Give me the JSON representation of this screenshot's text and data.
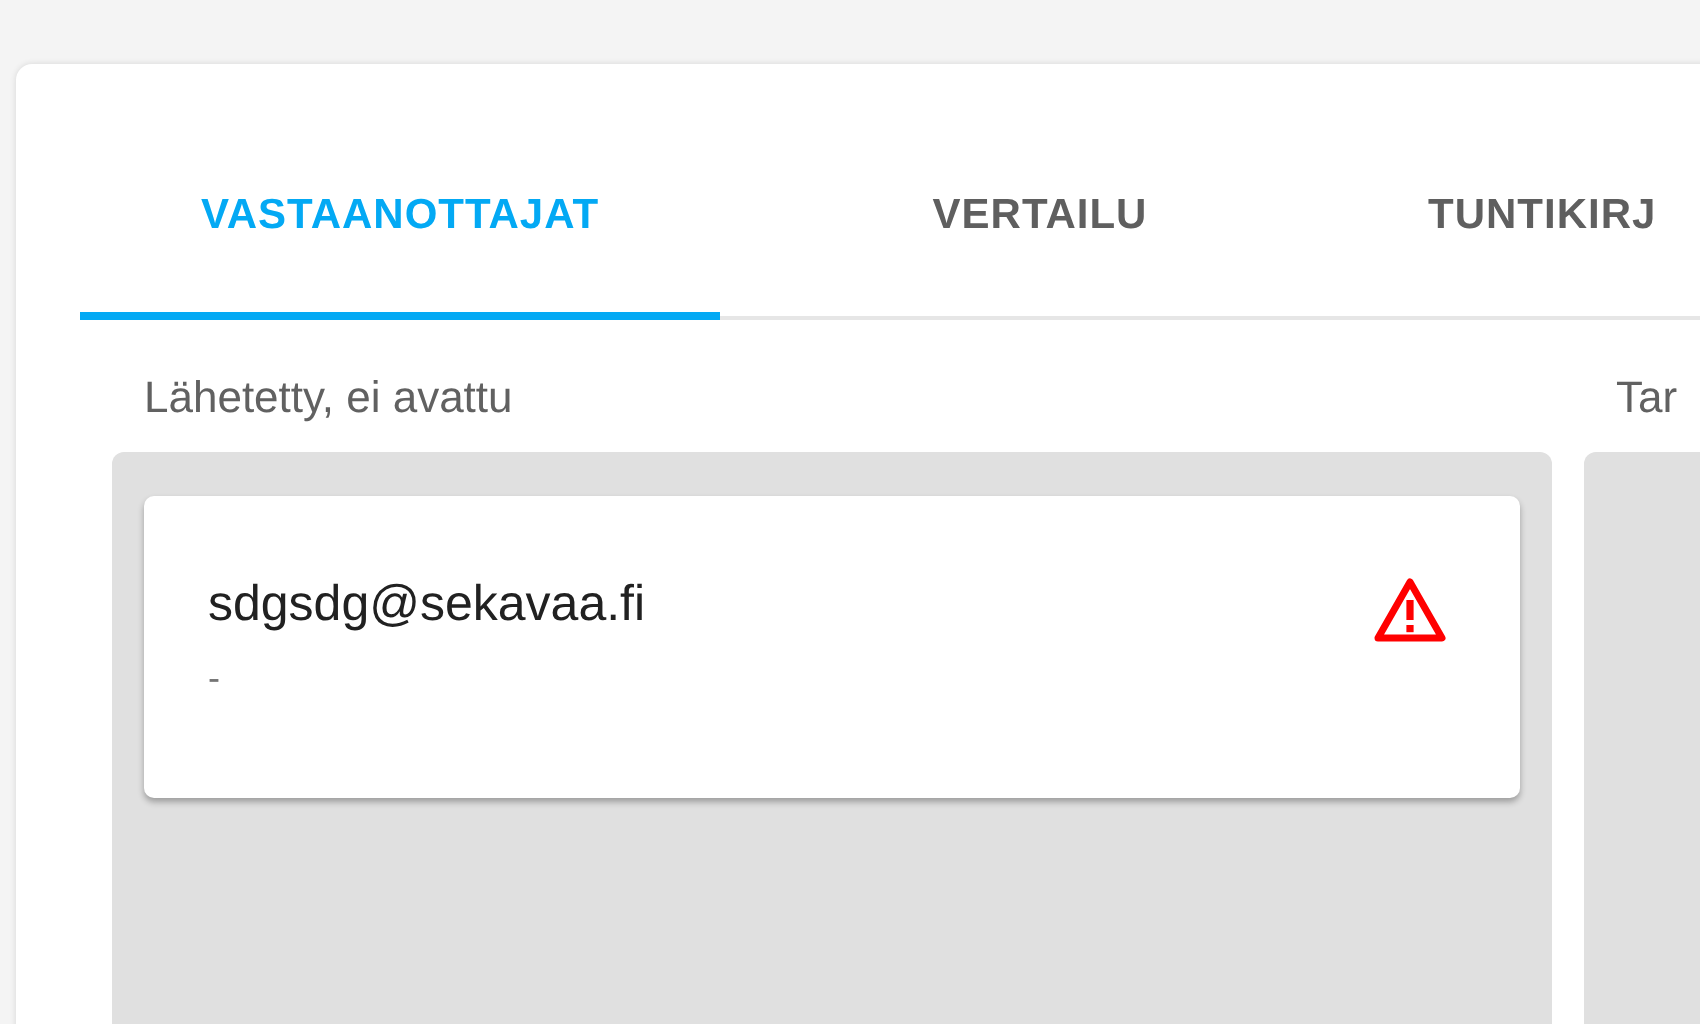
{
  "tabs": [
    {
      "label": "VASTAANOTTAJAT",
      "selected": true
    },
    {
      "label": "VERTAILU",
      "selected": false
    },
    {
      "label": "TUNTIKIRJ",
      "selected": false
    }
  ],
  "columns": [
    {
      "title": "Lähetetty, ei avattu",
      "cards": [
        {
          "email": "sdgsdg@sekavaa.fi",
          "detail": "-",
          "warning": true
        }
      ]
    },
    {
      "title": "Tar"
    }
  ]
}
